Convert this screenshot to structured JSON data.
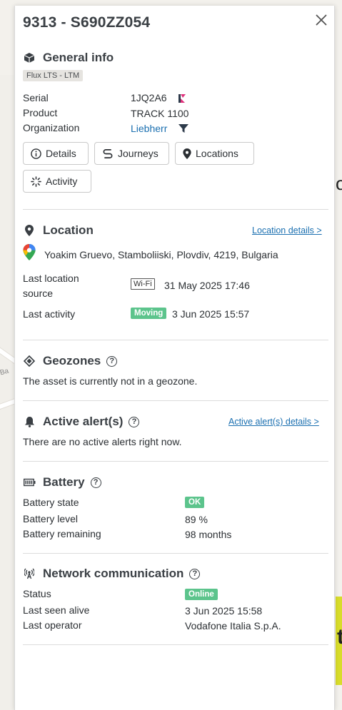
{
  "header": {
    "title": "9313 - S690ZZ054",
    "close_icon": "close-icon"
  },
  "general_info": {
    "title": "General info",
    "tag": "Flux LTS - LTM",
    "fields": [
      {
        "label": "Serial",
        "value": "1JQ2A6"
      },
      {
        "label": "Product",
        "value": "TRACK 1100"
      },
      {
        "label": "Organization",
        "value": "Liebherr"
      }
    ],
    "buttons": [
      {
        "label": "Details",
        "icon": "info-icon"
      },
      {
        "label": "Journeys",
        "icon": "route-icon"
      },
      {
        "label": "Locations",
        "icon": "pin-icon"
      },
      {
        "label": "Activity",
        "icon": "activity-icon"
      }
    ]
  },
  "location": {
    "title": "Location",
    "details_link": "Location details >",
    "address": "Yoakim Gruevo, Stamboliiski, Plovdiv, 4219, Bulgaria",
    "last_location_source_label": "Last location source",
    "source_badge": "Wi-Fi",
    "source_time": "31 May 2025 17:46",
    "last_activity_label": "Last activity",
    "activity_badge": "Moving",
    "activity_time": "3 Jun 2025 15:57"
  },
  "geozones": {
    "title": "Geozones",
    "help": "?",
    "message": "The asset is currently not in a geozone."
  },
  "alerts": {
    "title": "Active alert(s)",
    "help": "?",
    "details_link": "Active alert(s) details >",
    "message": "There are no active alerts right now."
  },
  "battery": {
    "title": "Battery",
    "help": "?",
    "state_label": "Battery state",
    "state_badge": "OK",
    "level_label": "Battery level",
    "level_value": "89 %",
    "remaining_label": "Battery remaining",
    "remaining_value": "98 months"
  },
  "network": {
    "title": "Network communication",
    "help": "?",
    "status_label": "Status",
    "status_badge": "Online",
    "seen_label": "Last seen alive",
    "seen_value": "3 Jun 2025 15:58",
    "operator_label": "Last operator",
    "operator_value": "Vodafone Italia S.p.A."
  },
  "background": {
    "edge_text": "o",
    "edge_text_2": "t",
    "map_label": "Ba"
  },
  "colors": {
    "link": "#1a6fb0",
    "badge_green": "#5cc48c",
    "flag_dark": "#2d3a4a",
    "flag_pink": "#e0317c"
  }
}
